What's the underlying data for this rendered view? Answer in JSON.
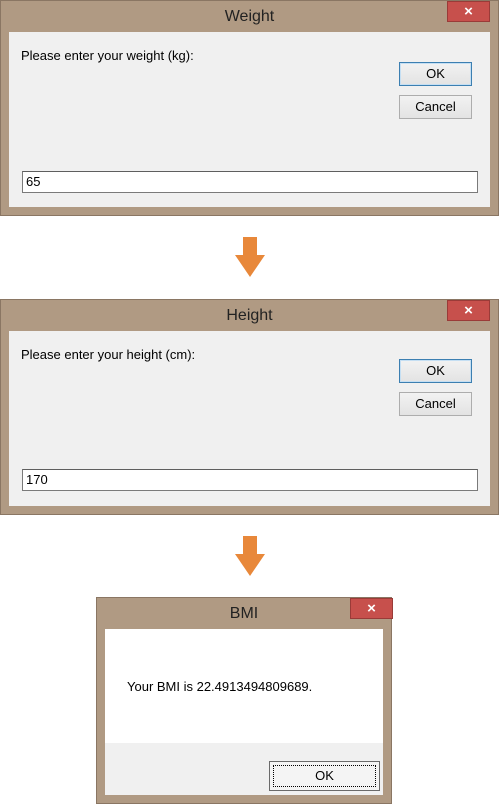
{
  "colors": {
    "frame": "#b09a83",
    "close": "#c7504c",
    "arrow": "#e8883a",
    "client": "#f0f0f0"
  },
  "weight_dialog": {
    "title": "Weight",
    "close_icon": "×",
    "prompt": "Please enter your weight (kg):",
    "ok_label": "OK",
    "cancel_label": "Cancel",
    "input_value": "65"
  },
  "height_dialog": {
    "title": "Height",
    "close_icon": "×",
    "prompt": "Please enter your height (cm):",
    "ok_label": "OK",
    "cancel_label": "Cancel",
    "input_value": "170"
  },
  "bmi_dialog": {
    "title": "BMI",
    "close_icon": "×",
    "message": "Your BMI is 22.4913494809689.",
    "ok_label": "OK"
  },
  "flow_arrows": [
    "arrow-down-icon",
    "arrow-down-icon"
  ]
}
